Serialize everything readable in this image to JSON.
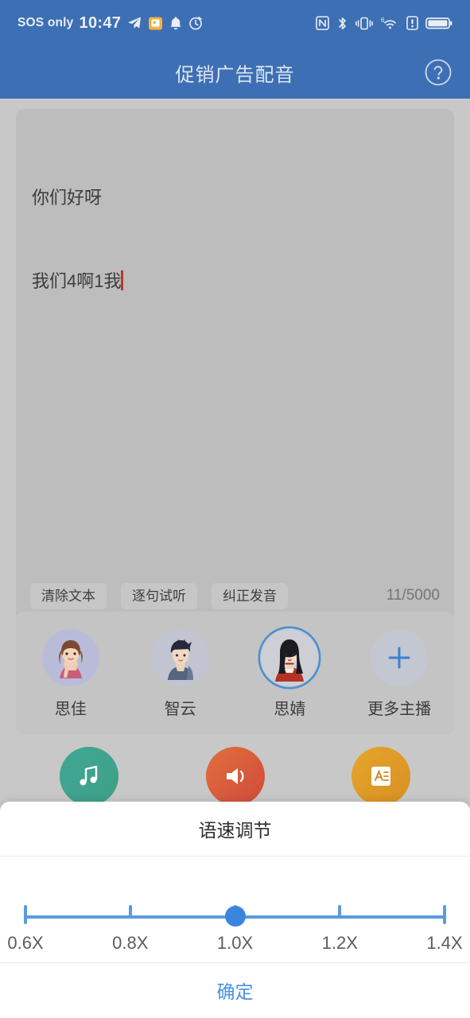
{
  "status_bar": {
    "carrier": "SOS only",
    "time": "10:47",
    "left_icons": [
      "telegram-icon",
      "note-icon",
      "bell-icon",
      "clock-icon"
    ],
    "right_icons": [
      "nfc-icon",
      "bluetooth-icon",
      "vibrate-icon",
      "wifi-6-icon",
      "alert-icon",
      "battery-icon"
    ],
    "background": "#3d6fb4"
  },
  "app_bar": {
    "title": "促销广告配音",
    "help_icon": "help-circle-icon",
    "background": "#3d6fb4"
  },
  "editor": {
    "line1": "你们好呀",
    "line2": "我们4啊1我",
    "caret_color": "#b33a2e",
    "buttons": [
      {
        "label": "清除文本",
        "name": "clear-text-button"
      },
      {
        "label": "逐句试听",
        "name": "preview-sentence-button"
      },
      {
        "label": "纠正发音",
        "name": "fix-pronunciation-button"
      }
    ],
    "counter": "11/5000"
  },
  "speakers": [
    {
      "name": "思佳",
      "selected": false
    },
    {
      "name": "智云",
      "selected": false
    },
    {
      "name": "思婧",
      "selected": true
    },
    {
      "name": "更多主播",
      "selected": false,
      "icon": "plus-icon"
    }
  ],
  "tools": [
    {
      "name": "background-music-tool",
      "icon": "music-note-icon",
      "color": "#3aa08f"
    },
    {
      "name": "sound-effect-tool",
      "icon": "sound-wave-icon",
      "color": "#d8603c"
    },
    {
      "name": "text-style-tool",
      "icon": "text-format-icon",
      "color": "#dda02a"
    }
  ],
  "speed_sheet": {
    "title": "语速调节",
    "ticks": [
      "0.6X",
      "0.8X",
      "1.0X",
      "1.2X",
      "1.4X"
    ],
    "selected_value": "1.0X",
    "selected_index": 2,
    "accent": "#3a86de",
    "confirm_label": "确定"
  }
}
